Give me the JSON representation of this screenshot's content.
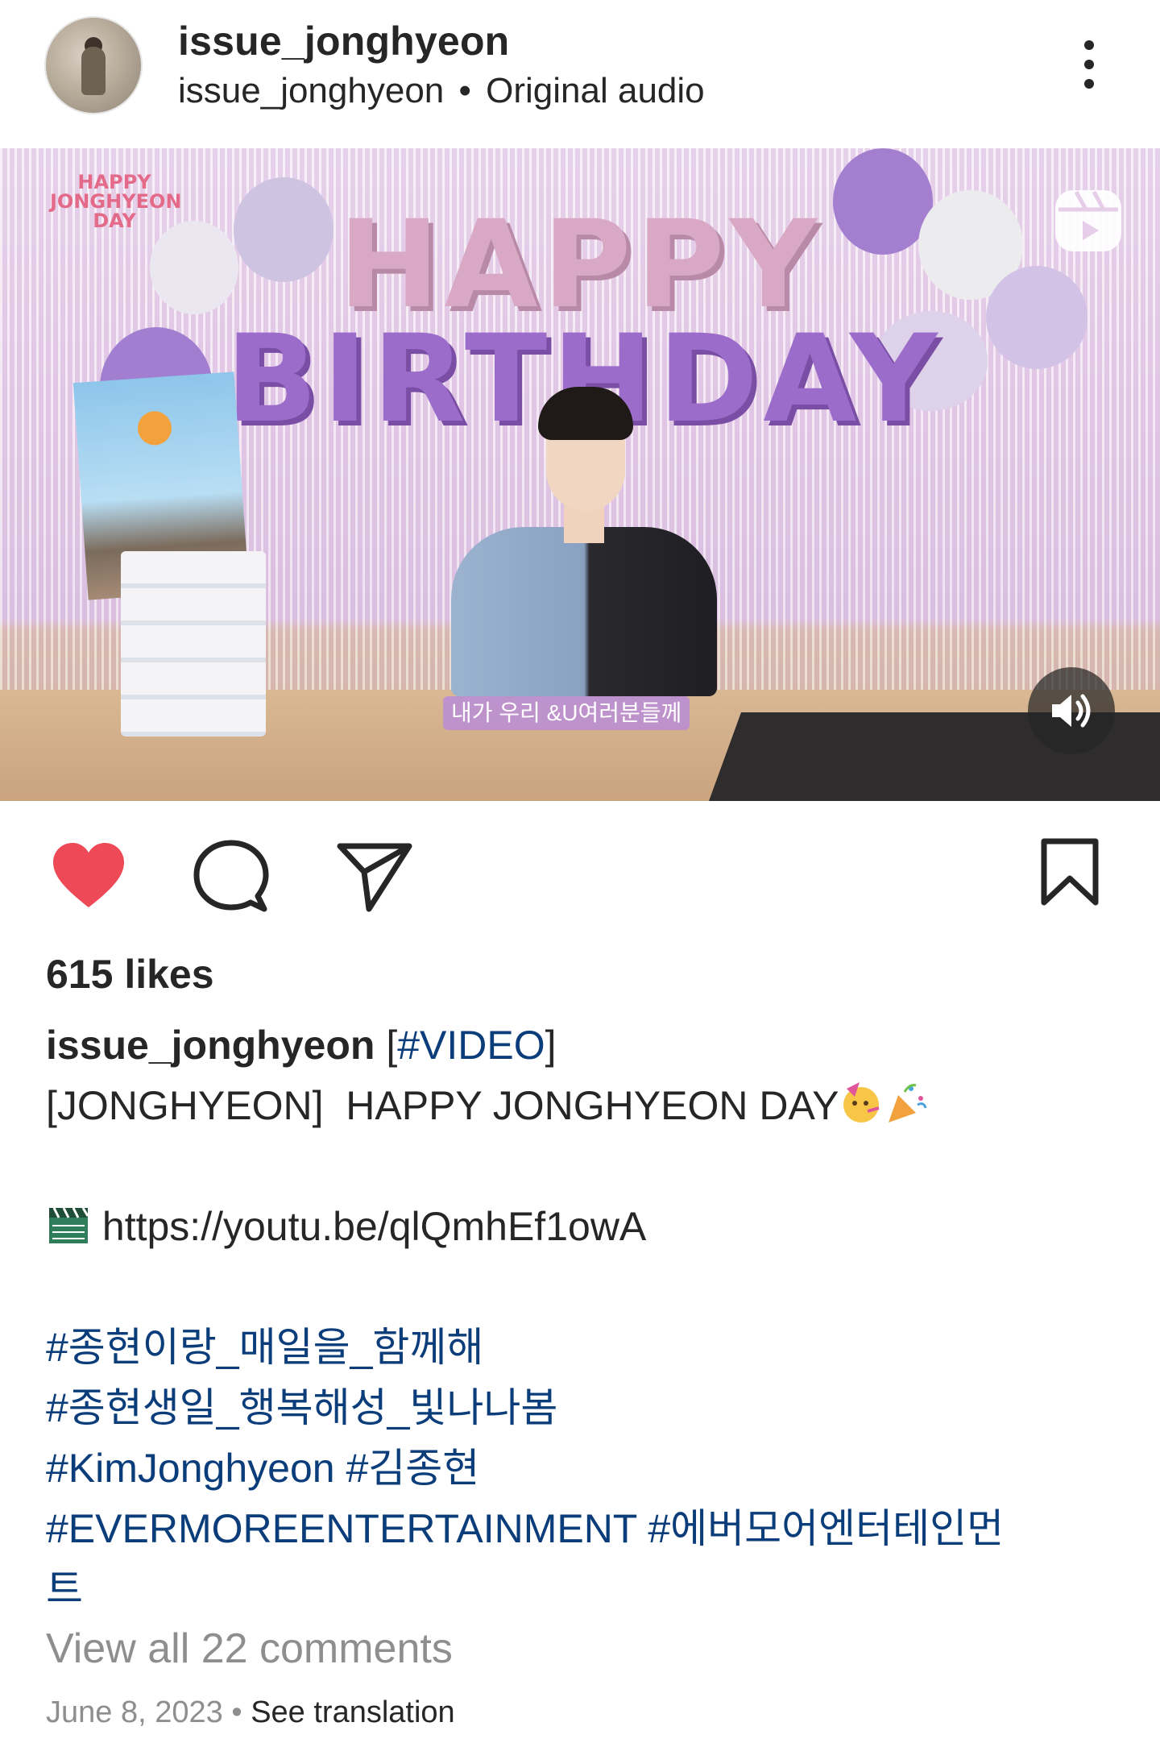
{
  "header": {
    "username": "issue_jonghyeon",
    "sub_user": "issue_jonghyeon",
    "separator": "•",
    "audio": "Original audio",
    "more_icon": "more-vertical-icon"
  },
  "media": {
    "banner_line1": "HAPPY",
    "banner_line2": "JONGHYEON",
    "banner_line3": "DAY",
    "balloon_line1": "HAPPY",
    "balloon_line2": "BIRTHDAY",
    "subtitle": "내가 우리 &U여러분들께",
    "reels_icon": "reels-icon",
    "audio_icon": "speaker-on-icon"
  },
  "actions": {
    "like_icon": "heart-filled-icon",
    "comment_icon": "comment-icon",
    "share_icon": "send-icon",
    "save_icon": "bookmark-icon",
    "liked": true,
    "like_color": "#ed4956"
  },
  "post": {
    "likes": "615 likes",
    "caption_user": "issue_jonghyeon",
    "caption_tag_open": "[",
    "caption_tag": "#VIDEO",
    "caption_tag_close": "]",
    "line_title": "[JONGHYEON]  HAPPY JONGHYEON DAY",
    "link": "https://youtu.be/qlQmhEf1owA",
    "hashtags_line1": "#종현이랑_매일을_함께해",
    "hashtags_line2": "#종현생일_행복해성_빛나나봄",
    "hashtag_a": "#KimJonghyeon",
    "hashtag_b": "#김종현",
    "hashtag_c": "#EVERMOREENTERTAINMENT",
    "hashtag_d": "#에버모어엔터테인먼",
    "hashtag_d_cont": "트",
    "hashtag_color": "#0a3d7a",
    "emojis": [
      "partying-face-emoji",
      "party-popper-emoji",
      "clapper-board-emoji"
    ]
  },
  "footer": {
    "view_comments": "View all 22 comments",
    "date": "June 8, 2023",
    "dot": "•",
    "see_translation": "See translation"
  }
}
